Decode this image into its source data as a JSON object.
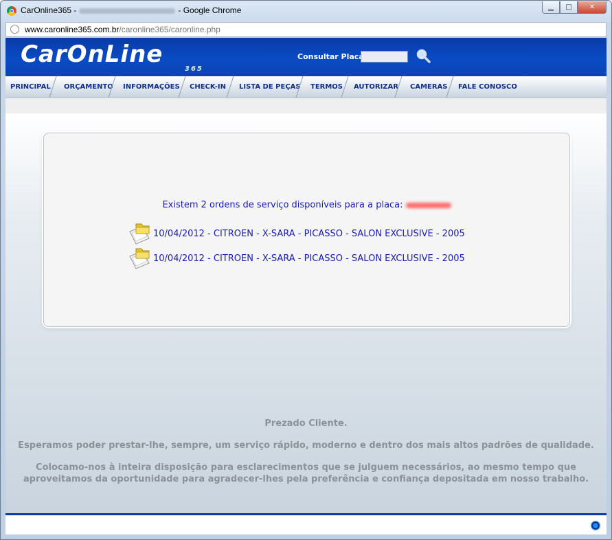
{
  "window": {
    "title_prefix": "CarOnline365 -",
    "title_suffix": "- Google Chrome",
    "minimize": "▁",
    "maximize": "□",
    "close": "✕"
  },
  "address": {
    "host": "www.caronline365.com.br",
    "path": "/caronline365/caronline.php"
  },
  "header": {
    "logo": "CarOnLine",
    "logo_sub": "365",
    "search_label": "Consultar Placa",
    "search_value": ""
  },
  "nav": {
    "items": [
      {
        "label": "PRINCIPAL"
      },
      {
        "label": "ORÇAMENTO"
      },
      {
        "label": "INFORMAÇÕES"
      },
      {
        "label": "CHECK-IN"
      },
      {
        "label": "LISTA DE PEÇAS"
      },
      {
        "label": "TERMOS"
      },
      {
        "label": "AUTORIZAR"
      },
      {
        "label": "CAMERAS"
      },
      {
        "label": "FALE CONOSCO"
      }
    ]
  },
  "panel": {
    "message": "Existem 2 ordens de serviço disponíveis para a placa:",
    "orders": [
      {
        "text": "10/04/2012 - CITROEN - X-SARA - PICASSO - SALON EXCLUSIVE - 2005"
      },
      {
        "text": "10/04/2012 - CITROEN - X-SARA - PICASSO - SALON EXCLUSIVE - 2005"
      }
    ]
  },
  "footer": {
    "greeting": "Prezado Cliente.",
    "line1": "Esperamos poder prestar-lhe, sempre, um serviço rápido, moderno e dentro dos mais altos padrões de qualidade.",
    "line2a": "Colocamo-nos à inteira disposição para esclarecimentos que se julguem necessários, ao mesmo tempo que",
    "line2b": "aproveitamos da oportunidade para agradecer-lhes pela preferência e confiança depositada em nosso trabalho."
  }
}
